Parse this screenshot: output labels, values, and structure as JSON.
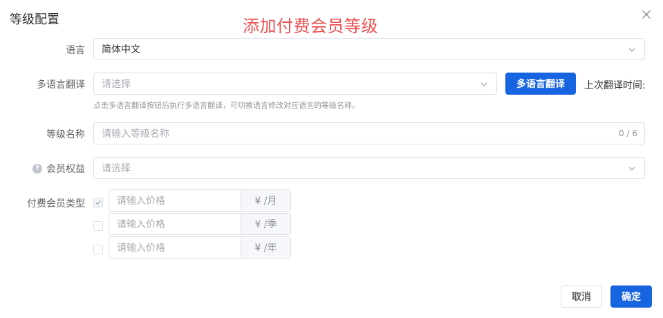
{
  "dialog": {
    "title": "等级配置",
    "annotation": "添加付费会员等级"
  },
  "form": {
    "language": {
      "label": "语言",
      "value": "简体中文"
    },
    "translation": {
      "label": "多语言翻译",
      "placeholder": "请选择",
      "button_label": "多语言翻译",
      "last_time_label": "上次翻译时间:",
      "hint": "点击多语言翻译按钮后执行多语言翻译，可切换语言修改对应语言的等级名称。"
    },
    "level_name": {
      "label": "等级名称",
      "placeholder": "请输入等级名称",
      "counter": "0 / 6"
    },
    "benefits": {
      "label": "会员权益",
      "placeholder": "请选择"
    },
    "paid_type": {
      "label": "付费会员类型",
      "options": [
        {
          "checked": true,
          "placeholder": "请输入价格",
          "unit": "¥ /月"
        },
        {
          "checked": false,
          "placeholder": "请输入价格",
          "unit": "¥ /季"
        },
        {
          "checked": false,
          "placeholder": "请输入价格",
          "unit": "¥ /年"
        }
      ]
    }
  },
  "footer": {
    "cancel_label": "取消",
    "confirm_label": "确定"
  },
  "colors": {
    "primary": "#1764e0",
    "annotation": "#ee4f4f"
  }
}
